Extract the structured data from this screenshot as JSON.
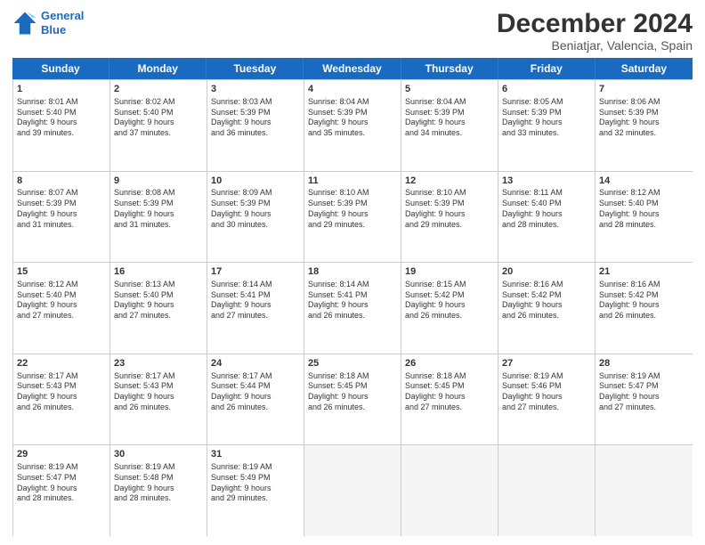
{
  "header": {
    "logo_line1": "General",
    "logo_line2": "Blue",
    "month": "December 2024",
    "location": "Beniatjar, Valencia, Spain"
  },
  "weekdays": [
    "Sunday",
    "Monday",
    "Tuesday",
    "Wednesday",
    "Thursday",
    "Friday",
    "Saturday"
  ],
  "rows": [
    [
      {
        "day": "",
        "empty": true,
        "info": ""
      },
      {
        "day": "2",
        "empty": false,
        "info": "Sunrise: 8:02 AM\nSunset: 5:40 PM\nDaylight: 9 hours\nand 37 minutes."
      },
      {
        "day": "3",
        "empty": false,
        "info": "Sunrise: 8:03 AM\nSunset: 5:39 PM\nDaylight: 9 hours\nand 36 minutes."
      },
      {
        "day": "4",
        "empty": false,
        "info": "Sunrise: 8:04 AM\nSunset: 5:39 PM\nDaylight: 9 hours\nand 35 minutes."
      },
      {
        "day": "5",
        "empty": false,
        "info": "Sunrise: 8:04 AM\nSunset: 5:39 PM\nDaylight: 9 hours\nand 34 minutes."
      },
      {
        "day": "6",
        "empty": false,
        "info": "Sunrise: 8:05 AM\nSunset: 5:39 PM\nDaylight: 9 hours\nand 33 minutes."
      },
      {
        "day": "7",
        "empty": false,
        "info": "Sunrise: 8:06 AM\nSunset: 5:39 PM\nDaylight: 9 hours\nand 32 minutes."
      }
    ],
    [
      {
        "day": "8",
        "empty": false,
        "info": "Sunrise: 8:07 AM\nSunset: 5:39 PM\nDaylight: 9 hours\nand 31 minutes."
      },
      {
        "day": "9",
        "empty": false,
        "info": "Sunrise: 8:08 AM\nSunset: 5:39 PM\nDaylight: 9 hours\nand 31 minutes."
      },
      {
        "day": "10",
        "empty": false,
        "info": "Sunrise: 8:09 AM\nSunset: 5:39 PM\nDaylight: 9 hours\nand 30 minutes."
      },
      {
        "day": "11",
        "empty": false,
        "info": "Sunrise: 8:10 AM\nSunset: 5:39 PM\nDaylight: 9 hours\nand 29 minutes."
      },
      {
        "day": "12",
        "empty": false,
        "info": "Sunrise: 8:10 AM\nSunset: 5:39 PM\nDaylight: 9 hours\nand 29 minutes."
      },
      {
        "day": "13",
        "empty": false,
        "info": "Sunrise: 8:11 AM\nSunset: 5:40 PM\nDaylight: 9 hours\nand 28 minutes."
      },
      {
        "day": "14",
        "empty": false,
        "info": "Sunrise: 8:12 AM\nSunset: 5:40 PM\nDaylight: 9 hours\nand 28 minutes."
      }
    ],
    [
      {
        "day": "15",
        "empty": false,
        "info": "Sunrise: 8:12 AM\nSunset: 5:40 PM\nDaylight: 9 hours\nand 27 minutes."
      },
      {
        "day": "16",
        "empty": false,
        "info": "Sunrise: 8:13 AM\nSunset: 5:40 PM\nDaylight: 9 hours\nand 27 minutes."
      },
      {
        "day": "17",
        "empty": false,
        "info": "Sunrise: 8:14 AM\nSunset: 5:41 PM\nDaylight: 9 hours\nand 27 minutes."
      },
      {
        "day": "18",
        "empty": false,
        "info": "Sunrise: 8:14 AM\nSunset: 5:41 PM\nDaylight: 9 hours\nand 26 minutes."
      },
      {
        "day": "19",
        "empty": false,
        "info": "Sunrise: 8:15 AM\nSunset: 5:42 PM\nDaylight: 9 hours\nand 26 minutes."
      },
      {
        "day": "20",
        "empty": false,
        "info": "Sunrise: 8:16 AM\nSunset: 5:42 PM\nDaylight: 9 hours\nand 26 minutes."
      },
      {
        "day": "21",
        "empty": false,
        "info": "Sunrise: 8:16 AM\nSunset: 5:42 PM\nDaylight: 9 hours\nand 26 minutes."
      }
    ],
    [
      {
        "day": "22",
        "empty": false,
        "info": "Sunrise: 8:17 AM\nSunset: 5:43 PM\nDaylight: 9 hours\nand 26 minutes."
      },
      {
        "day": "23",
        "empty": false,
        "info": "Sunrise: 8:17 AM\nSunset: 5:43 PM\nDaylight: 9 hours\nand 26 minutes."
      },
      {
        "day": "24",
        "empty": false,
        "info": "Sunrise: 8:17 AM\nSunset: 5:44 PM\nDaylight: 9 hours\nand 26 minutes."
      },
      {
        "day": "25",
        "empty": false,
        "info": "Sunrise: 8:18 AM\nSunset: 5:45 PM\nDaylight: 9 hours\nand 26 minutes."
      },
      {
        "day": "26",
        "empty": false,
        "info": "Sunrise: 8:18 AM\nSunset: 5:45 PM\nDaylight: 9 hours\nand 27 minutes."
      },
      {
        "day": "27",
        "empty": false,
        "info": "Sunrise: 8:19 AM\nSunset: 5:46 PM\nDaylight: 9 hours\nand 27 minutes."
      },
      {
        "day": "28",
        "empty": false,
        "info": "Sunrise: 8:19 AM\nSunset: 5:47 PM\nDaylight: 9 hours\nand 27 minutes."
      }
    ],
    [
      {
        "day": "29",
        "empty": false,
        "info": "Sunrise: 8:19 AM\nSunset: 5:47 PM\nDaylight: 9 hours\nand 28 minutes."
      },
      {
        "day": "30",
        "empty": false,
        "info": "Sunrise: 8:19 AM\nSunset: 5:48 PM\nDaylight: 9 hours\nand 28 minutes."
      },
      {
        "day": "31",
        "empty": false,
        "info": "Sunrise: 8:19 AM\nSunset: 5:49 PM\nDaylight: 9 hours\nand 29 minutes."
      },
      {
        "day": "",
        "empty": true,
        "info": ""
      },
      {
        "day": "",
        "empty": true,
        "info": ""
      },
      {
        "day": "",
        "empty": true,
        "info": ""
      },
      {
        "day": "",
        "empty": true,
        "info": ""
      }
    ]
  ],
  "row0_sun": {
    "day": "1",
    "info": "Sunrise: 8:01 AM\nSunset: 5:40 PM\nDaylight: 9 hours\nand 39 minutes."
  }
}
